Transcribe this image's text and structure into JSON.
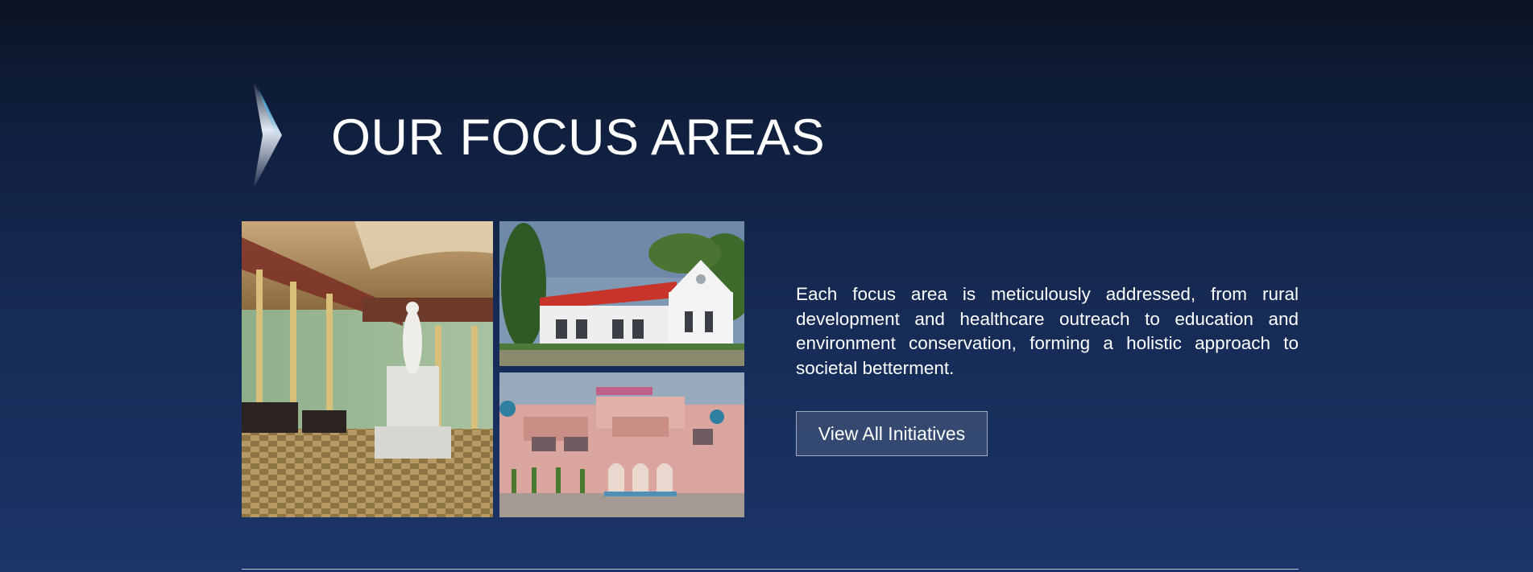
{
  "section": {
    "heading": "OUR FOCUS AREAS",
    "description": "Each focus area is meticulously addressed, from rural development and healthcare outreach to education and environment conservation, forming a holistic approach to societal betterment.",
    "cta_label": "View All Initiatives"
  },
  "icons": {
    "chevron": "chevron-right-icon"
  },
  "colors": {
    "background_top": "#0b1324",
    "background_bottom": "#1b3568",
    "chevron_accent": "#4fb6e8",
    "text": "#ffffff"
  }
}
